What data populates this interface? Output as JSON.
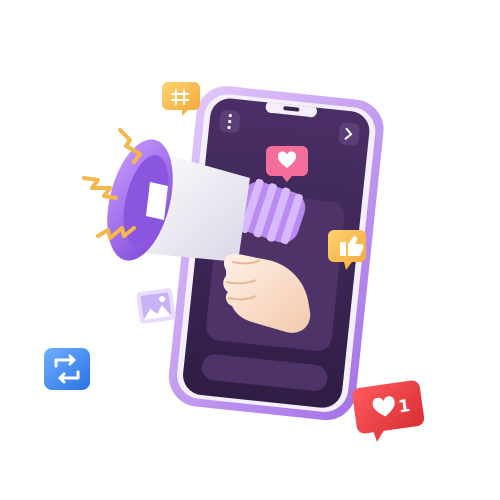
{
  "illustration": {
    "subject": "megaphone-coming-out-of-smartphone",
    "like_badge": {
      "count": "1"
    },
    "icons": {
      "hashtag": "hashtag-icon",
      "thumbs_up": "thumbs-up-icon",
      "heart": "heart-icon",
      "image": "image-icon",
      "repost": "repost-icon",
      "menu": "dots-menu-icon",
      "next": "chevron-right-icon"
    },
    "colors": {
      "phone_frame": "#c79bf2",
      "screen": "#3a2550",
      "megaphone_purple": "#b07ef0",
      "badge_red": "#e8353a",
      "badge_yellow": "#f5b94a",
      "badge_blue": "#3d8cf5",
      "badge_pink": "#f36f9a"
    }
  }
}
